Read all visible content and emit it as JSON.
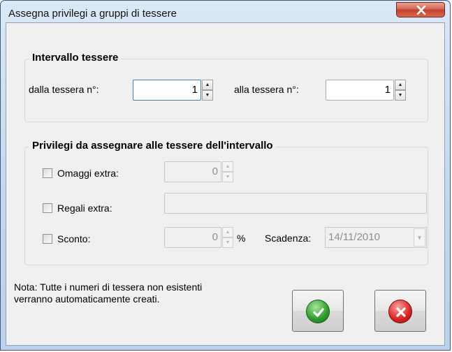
{
  "window": {
    "title": "Assegna privilegi a gruppi di tessere"
  },
  "range_group": {
    "legend": "Intervallo tessere",
    "from_label": "dalla tessera n°:",
    "from_value": "1",
    "to_label": "alla tessera n°:",
    "to_value": "1"
  },
  "privileges_group": {
    "legend": "Privilegi da assegnare alle tessere dell'intervallo",
    "omaggi_label": "Omaggi extra:",
    "omaggi_value": "0",
    "regali_label": "Regali extra:",
    "regali_value": "",
    "sconto_label": "Sconto:",
    "sconto_value": "0",
    "percent_symbol": "%",
    "scadenza_label": "Scadenza:",
    "scadenza_value": "14/11/2010"
  },
  "note": "Nota: Tutte i numeri di tessera non esistenti verranno automaticamente creati.",
  "icons": {
    "ok": "checkmark-icon",
    "cancel": "x-icon",
    "close": "close-icon"
  },
  "colors": {
    "ok_green": "#2f9a2c",
    "cancel_red": "#d82424",
    "close_red": "#c3402e"
  }
}
